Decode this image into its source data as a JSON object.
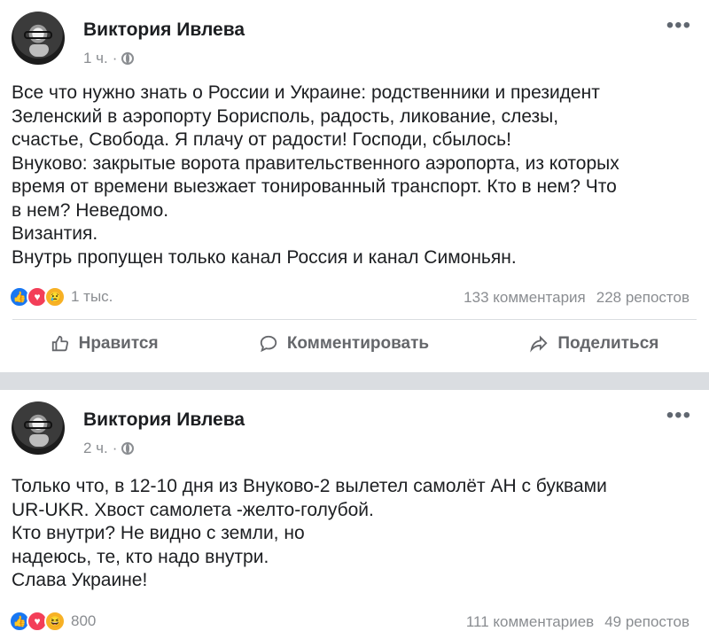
{
  "posts": [
    {
      "author": "Виктория Ивлева",
      "time": "1 ч.",
      "dot": "·",
      "more": "•••",
      "lines": [
        "Все что нужно знать о России и Украине: родственники и президент",
        "Зеленский в аэропорту Борисполь, радость, ликование, слезы,",
        "счастье, Свобода. Я плачу от радости! Господи, сбылось!",
        "Внуково: закрытые ворота правительственного аэропорта, из которых",
        "время от времени выезжает тонированный транспорт. Кто в нем? Что",
        "в нем? Неведомо.",
        "Византия.",
        "Внутрь пропущен только канал Россия и канал Симоньян."
      ],
      "reaction_count": "1 тыс.",
      "comments": "133 комментария",
      "shares": "228 репостов",
      "reactions": [
        "like",
        "love",
        "sad"
      ]
    },
    {
      "author": "Виктория Ивлева",
      "time": "2 ч.",
      "dot": "·",
      "more": "•••",
      "lines": [
        "Только что, в 12-10 дня из Внуково-2 вылетел самолёт АН с буквами",
        "UR-UKR. Хвост самолета -желто-голубой.",
        "Кто внутри? Не видно с земли, но",
        "надеюсь, те, кто надо внутри.",
        "Слава Украине!"
      ],
      "reaction_count": "800",
      "comments": "111 комментариев",
      "shares": "49 репостов",
      "reactions": [
        "like",
        "love",
        "haha"
      ]
    }
  ],
  "actions": {
    "like": "Нравится",
    "comment": "Комментировать",
    "share": "Поделиться"
  },
  "colors": {
    "like": "#1877f2",
    "love": "#f33e58",
    "emoji": "#f7b125",
    "muted": "#8a8d91",
    "separator": "#dadde1"
  }
}
